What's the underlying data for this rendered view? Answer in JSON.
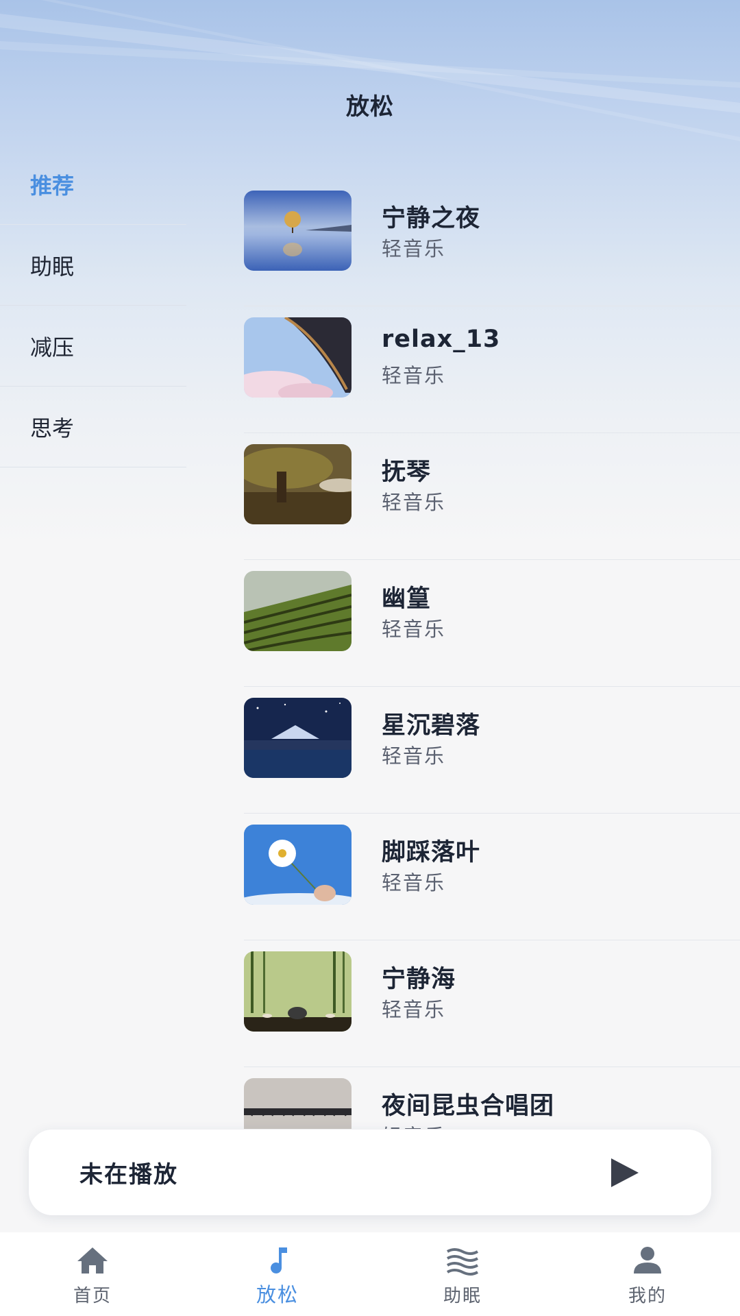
{
  "header": {
    "title": "放松"
  },
  "sidebar": {
    "items": [
      {
        "label": "推荐",
        "active": true
      },
      {
        "label": "助眠",
        "active": false
      },
      {
        "label": "减压",
        "active": false
      },
      {
        "label": "思考",
        "active": false
      }
    ]
  },
  "tracks": [
    {
      "title": "宁静之夜",
      "subtitle": "轻音乐"
    },
    {
      "title": "relax_13",
      "subtitle": "轻音乐"
    },
    {
      "title": "抚琴",
      "subtitle": "轻音乐"
    },
    {
      "title": "幽篁",
      "subtitle": "轻音乐"
    },
    {
      "title": "星沉碧落",
      "subtitle": "轻音乐"
    },
    {
      "title": "脚踩落叶",
      "subtitle": "轻音乐"
    },
    {
      "title": "宁静海",
      "subtitle": "轻音乐"
    },
    {
      "title": "夜间昆虫合唱团",
      "subtitle": "轻音乐"
    }
  ],
  "player": {
    "status": "未在播放",
    "button_icon": "play-icon"
  },
  "tabbar": {
    "tabs": [
      {
        "label": "首页",
        "icon": "home-icon",
        "active": false
      },
      {
        "label": "放松",
        "icon": "music-note-icon",
        "active": true
      },
      {
        "label": "助眠",
        "icon": "waves-icon",
        "active": false
      },
      {
        "label": "我的",
        "icon": "person-icon",
        "active": false
      }
    ]
  },
  "colors": {
    "accent": "#4a8fe0",
    "text": "#1d2535",
    "secondary_text": "#5b6170"
  }
}
